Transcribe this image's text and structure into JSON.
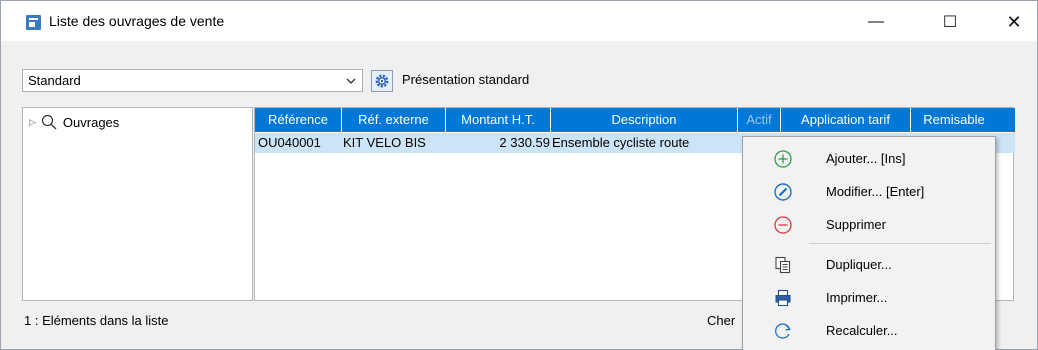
{
  "window": {
    "title": "Liste des ouvrages de vente",
    "min_glyph": "—",
    "max_glyph": "☐",
    "close_glyph": "✕"
  },
  "toolbar": {
    "presentation_value": "Standard",
    "presentation_label": "Présentation standard"
  },
  "tree": {
    "root_label": "Ouvrages"
  },
  "grid": {
    "columns": [
      "Référence",
      "Réf. externe",
      "Montant H.T.",
      "Description",
      "Actif",
      "Application tarif",
      "Remisable"
    ],
    "rows": [
      {
        "reference": "OU040001",
        "ref_externe": "KIT VELO BIS",
        "montant": "2 330.59",
        "description": "Ensemble cycliste route"
      }
    ]
  },
  "status": {
    "count_text": "1 : Eléments dans la liste",
    "search_text": "Cher"
  },
  "context_menu": {
    "items": [
      {
        "label": "Ajouter... [Ins]",
        "icon": "add-circle-icon"
      },
      {
        "label": "Modifier... [Enter]",
        "icon": "edit-pencil-icon"
      },
      {
        "label": "Supprimer",
        "icon": "remove-circle-icon"
      },
      {
        "label": "Dupliquer...",
        "icon": "duplicate-icon"
      },
      {
        "label": "Imprimer...",
        "icon": "printer-icon"
      },
      {
        "label": "Recalculer...",
        "icon": "refresh-icon"
      }
    ]
  },
  "colors": {
    "header_blue": "#0078d7",
    "selected_row": "#cce4f7",
    "add_green": "#2e9e45",
    "edit_blue": "#1f6fc5",
    "remove_red": "#d9363e"
  }
}
